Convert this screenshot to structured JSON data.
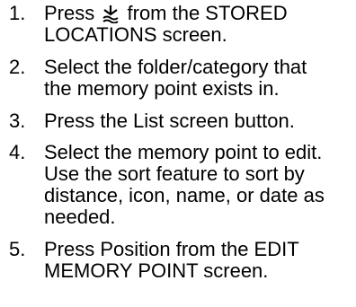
{
  "steps": [
    {
      "num": "1.",
      "line1_before": "Press",
      "icon": "mark-waypoint-icon",
      "line1_after": "from the STORED",
      "line2": "LOCATIONS screen."
    },
    {
      "num": "2.",
      "lines": [
        "Select the folder/category that",
        "the memory point exists in."
      ]
    },
    {
      "num": "3.",
      "lines": [
        "Press the List screen button."
      ]
    },
    {
      "num": "4.",
      "lines": [
        "Select the memory point to edit.",
        "Use the sort feature to sort by",
        "distance, icon, name, or date as",
        "needed."
      ]
    },
    {
      "num": "5.",
      "lines": [
        "Press Position from the EDIT",
        "MEMORY POINT screen."
      ]
    }
  ]
}
